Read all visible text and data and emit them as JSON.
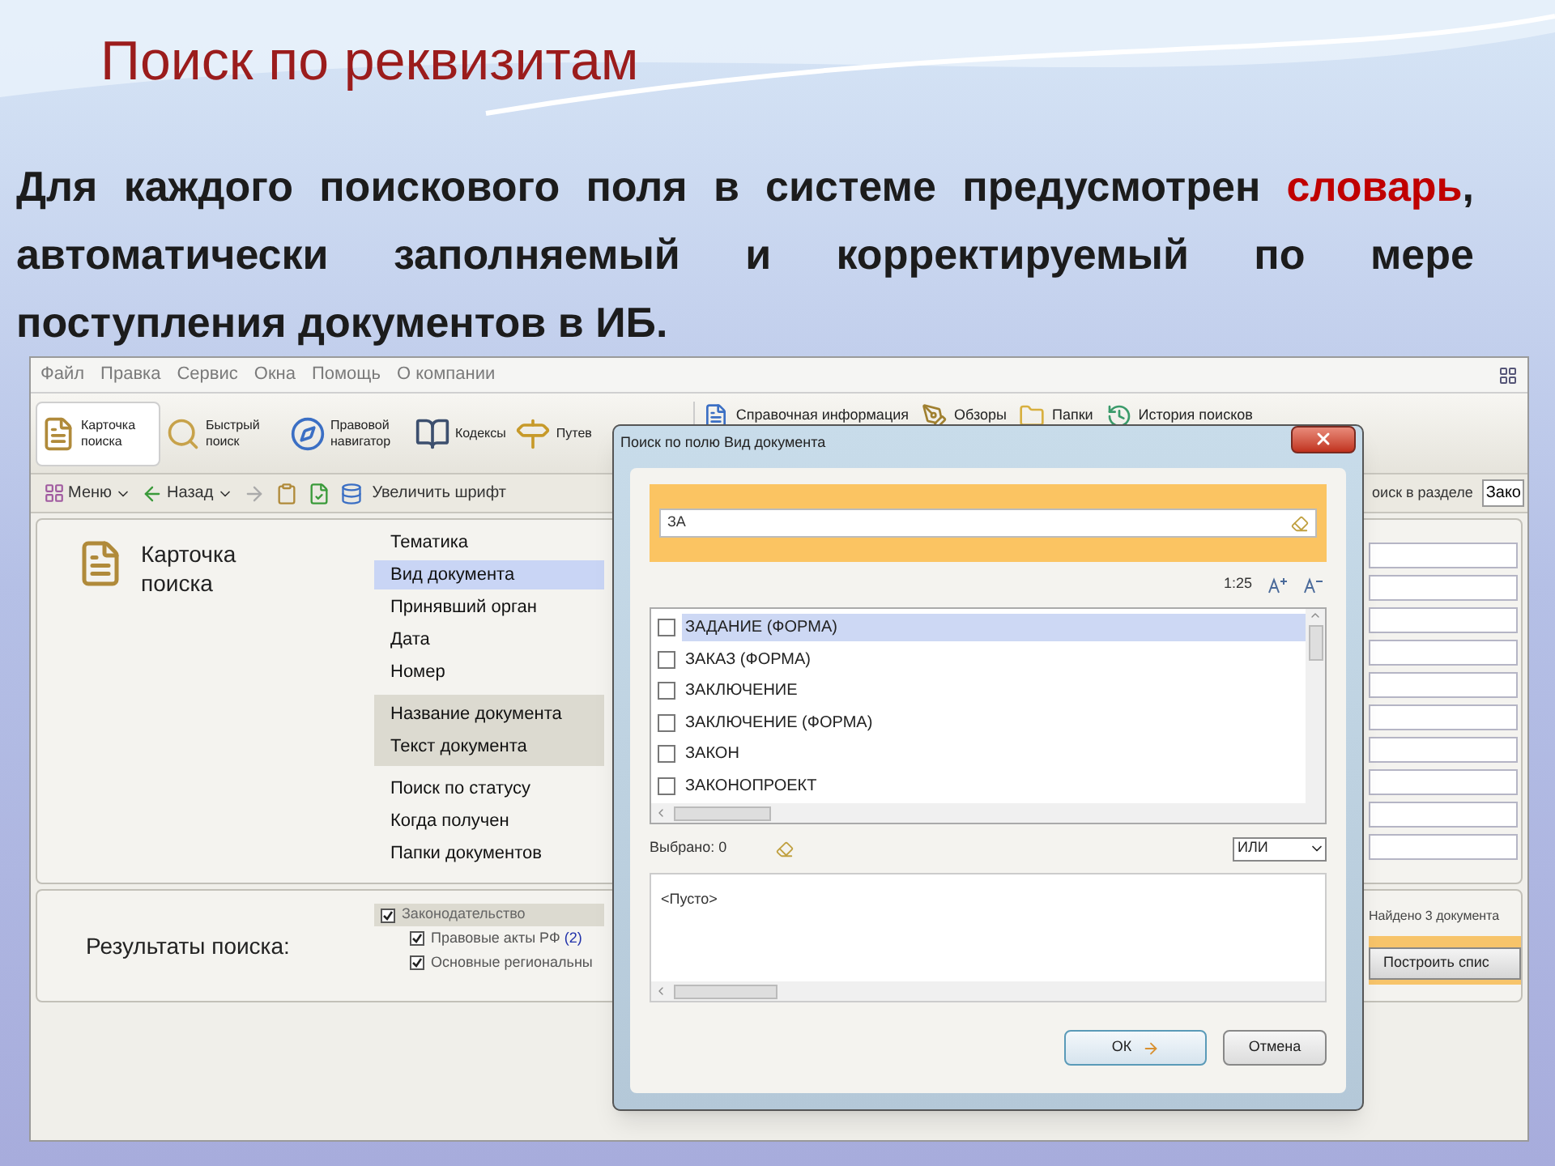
{
  "slide": {
    "title": "Поиск по реквизитам",
    "intro": [
      {
        "text": "Для каждого поискового поля в системе предусмотрен ",
        "highlight": false
      },
      {
        "text": "словарь",
        "highlight": true
      },
      {
        "text": ", автоматически заполняемый и корректируемый по мере поступления документов в ИБ.",
        "highlight": false
      }
    ]
  },
  "app": {
    "menu": [
      "Файл",
      "Правка",
      "Сервис",
      "Окна",
      "Помощь",
      "О компании"
    ],
    "main_tools": [
      {
        "label": "Карточка поиска",
        "kind": "card",
        "selected": true
      },
      {
        "label": "Быстрый поиск",
        "kind": "magnifier",
        "selected": false
      },
      {
        "label": "Правовой навигатор",
        "kind": "compass",
        "selected": false
      },
      {
        "label": "Кодексы",
        "kind": "book",
        "selected": false
      },
      {
        "label": "Путев",
        "kind": "signpost",
        "selected": false
      }
    ],
    "info_tools": [
      {
        "label": "Справочная информация",
        "kind": "info"
      },
      {
        "label": "Обзоры",
        "kind": "pen"
      },
      {
        "label": "Папки",
        "kind": "folder"
      },
      {
        "label": "История поисков",
        "kind": "history"
      }
    ],
    "nav": {
      "menu": "Меню",
      "back": "Назад",
      "zoom": "Увеличить шрифт"
    },
    "section_search": {
      "label": "оиск в разделе",
      "value": "Зако"
    },
    "card": {
      "title": "Карточка поиска",
      "field_groups": [
        {
          "shaded": false,
          "fields": [
            {
              "label": "Тематика",
              "selected": false
            },
            {
              "label": "Вид документа",
              "selected": true
            },
            {
              "label": "Принявший орган",
              "selected": false
            },
            {
              "label": "Дата",
              "selected": false
            },
            {
              "label": "Номер",
              "selected": false
            }
          ]
        },
        {
          "shaded": true,
          "fields": [
            {
              "label": "Название документа",
              "selected": false
            },
            {
              "label": "Текст документа",
              "selected": false
            }
          ]
        },
        {
          "shaded": false,
          "fields": [
            {
              "label": "Поиск по статусу",
              "selected": false
            },
            {
              "label": "Когда получен",
              "selected": false
            },
            {
              "label": "Папки документов",
              "selected": false
            }
          ]
        }
      ]
    },
    "results": {
      "label": "Результаты поиска:",
      "tree": [
        {
          "label": "Законодательство",
          "checked": true,
          "selected": true,
          "children": [
            {
              "label": "Правовые акты РФ",
              "count": "(2)",
              "checked": true,
              "selected": false
            },
            {
              "label": "Основные региональны",
              "checked": true,
              "selected": false
            }
          ]
        }
      ],
      "found": "Найдено 3 документа",
      "build_button": "Построить спис"
    }
  },
  "dialog": {
    "title": "Поиск по полю Вид документа",
    "query": "ЗА",
    "count": "1:25",
    "items": [
      {
        "label": "ЗАДАНИЕ (ФОРМА)",
        "checked": false,
        "selected": true
      },
      {
        "label": "ЗАКАЗ (ФОРМА)",
        "checked": false,
        "selected": false
      },
      {
        "label": "ЗАКЛЮЧЕНИЕ",
        "checked": false,
        "selected": false
      },
      {
        "label": "ЗАКЛЮЧЕНИЕ (ФОРМА)",
        "checked": false,
        "selected": false
      },
      {
        "label": "ЗАКОН",
        "checked": false,
        "selected": false
      },
      {
        "label": "ЗАКОНОПРОЕКТ",
        "checked": false,
        "selected": false
      }
    ],
    "chosen_label": "Выбрано: 0",
    "operator": "ИЛИ",
    "chosen_text": "<Пусто>",
    "ok": "ОК",
    "cancel": "Отмена"
  }
}
